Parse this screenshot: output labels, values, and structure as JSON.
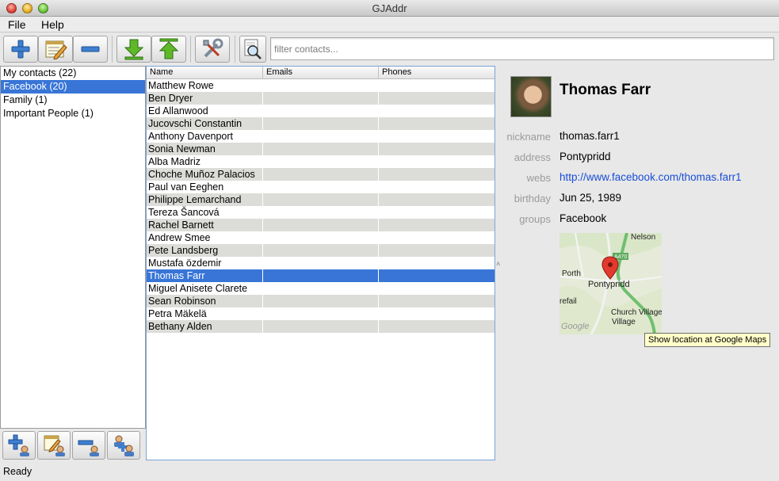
{
  "window": {
    "title": "GJAddr"
  },
  "menu": {
    "file": "File",
    "help": "Help"
  },
  "toolbar": {
    "buttons": [
      {
        "name": "add-contact-button",
        "icon": "plus-icon"
      },
      {
        "name": "edit-contact-button",
        "icon": "notepad-pencil-icon"
      },
      {
        "name": "remove-contact-button",
        "icon": "minus-icon"
      },
      {
        "name": "import-button",
        "icon": "green-down-arrow-icon"
      },
      {
        "name": "export-button",
        "icon": "green-up-arrow-icon"
      },
      {
        "name": "preferences-button",
        "icon": "tools-icon"
      },
      {
        "name": "find-button",
        "icon": "magnifier-icon"
      }
    ]
  },
  "search": {
    "placeholder": "filter contacts..."
  },
  "groups": [
    {
      "label": "My contacts (22)",
      "selected": false
    },
    {
      "label": "Facebook (20)",
      "selected": true
    },
    {
      "label": "Family (1)",
      "selected": false
    },
    {
      "label": "Important People (1)",
      "selected": false
    }
  ],
  "table": {
    "columns": [
      "Name",
      "Emails",
      "Phones"
    ],
    "rows": [
      {
        "name": "Matthew Rowe",
        "emails": "",
        "phones": ""
      },
      {
        "name": "Ben Dryer",
        "emails": "",
        "phones": ""
      },
      {
        "name": "Ed Allanwood",
        "emails": "",
        "phones": ""
      },
      {
        "name": "Jucovschi Constantin",
        "emails": "",
        "phones": ""
      },
      {
        "name": "Anthony Davenport",
        "emails": "",
        "phones": ""
      },
      {
        "name": "Sonia Newman",
        "emails": "",
        "phones": ""
      },
      {
        "name": "Alba Madriz",
        "emails": "",
        "phones": ""
      },
      {
        "name": "Choche Muñoz Palacios",
        "emails": "",
        "phones": ""
      },
      {
        "name": "Paul van Eeghen",
        "emails": "",
        "phones": ""
      },
      {
        "name": "Philippe Lemarchand",
        "emails": "",
        "phones": ""
      },
      {
        "name": "Tereza Šancová",
        "emails": "",
        "phones": ""
      },
      {
        "name": "Rachel Barnett",
        "emails": "",
        "phones": ""
      },
      {
        "name": "Andrew Smee",
        "emails": "",
        "phones": ""
      },
      {
        "name": "Pete Landsberg",
        "emails": "",
        "phones": ""
      },
      {
        "name": "Mustafa özdemir",
        "emails": "",
        "phones": ""
      },
      {
        "name": "Thomas Farr",
        "emails": "",
        "phones": ""
      },
      {
        "name": "Miguel Anisete Clarete",
        "emails": "",
        "phones": ""
      },
      {
        "name": "Sean Robinson",
        "emails": "",
        "phones": ""
      },
      {
        "name": "Petra Mäkelä",
        "emails": "",
        "phones": ""
      },
      {
        "name": "Bethany Alden",
        "emails": "",
        "phones": ""
      }
    ],
    "selected_row": 15
  },
  "details": {
    "name": "Thomas Farr",
    "fields": [
      {
        "label": "nickname",
        "value": "thomas.farr1",
        "link": false
      },
      {
        "label": "address",
        "value": "Pontypridd",
        "link": false
      },
      {
        "label": "webs",
        "value": "http://www.facebook.com/thomas.farr1",
        "link": true
      },
      {
        "label": "birthday",
        "value": "Jun 25, 1989",
        "link": false
      },
      {
        "label": "groups",
        "value": "Facebook",
        "link": false
      }
    ],
    "map": {
      "places": [
        "Nelson",
        "Porth",
        "Pontypridd",
        "refail",
        "Church Village"
      ],
      "road": "A470",
      "watermark": "Google",
      "tooltip": "Show location at Google Maps"
    }
  },
  "group_toolbar": {
    "buttons": [
      {
        "name": "add-group-button",
        "icon": "plus-group-icon"
      },
      {
        "name": "edit-group-button",
        "icon": "notepad-group-icon"
      },
      {
        "name": "remove-group-button",
        "icon": "minus-group-icon"
      },
      {
        "name": "manage-group-members-button",
        "icon": "group-members-icon"
      }
    ]
  },
  "status": "Ready",
  "colors": {
    "selection": "#3875d7",
    "alt_row": "#dcdcd8",
    "link": "#1a4ed8"
  }
}
